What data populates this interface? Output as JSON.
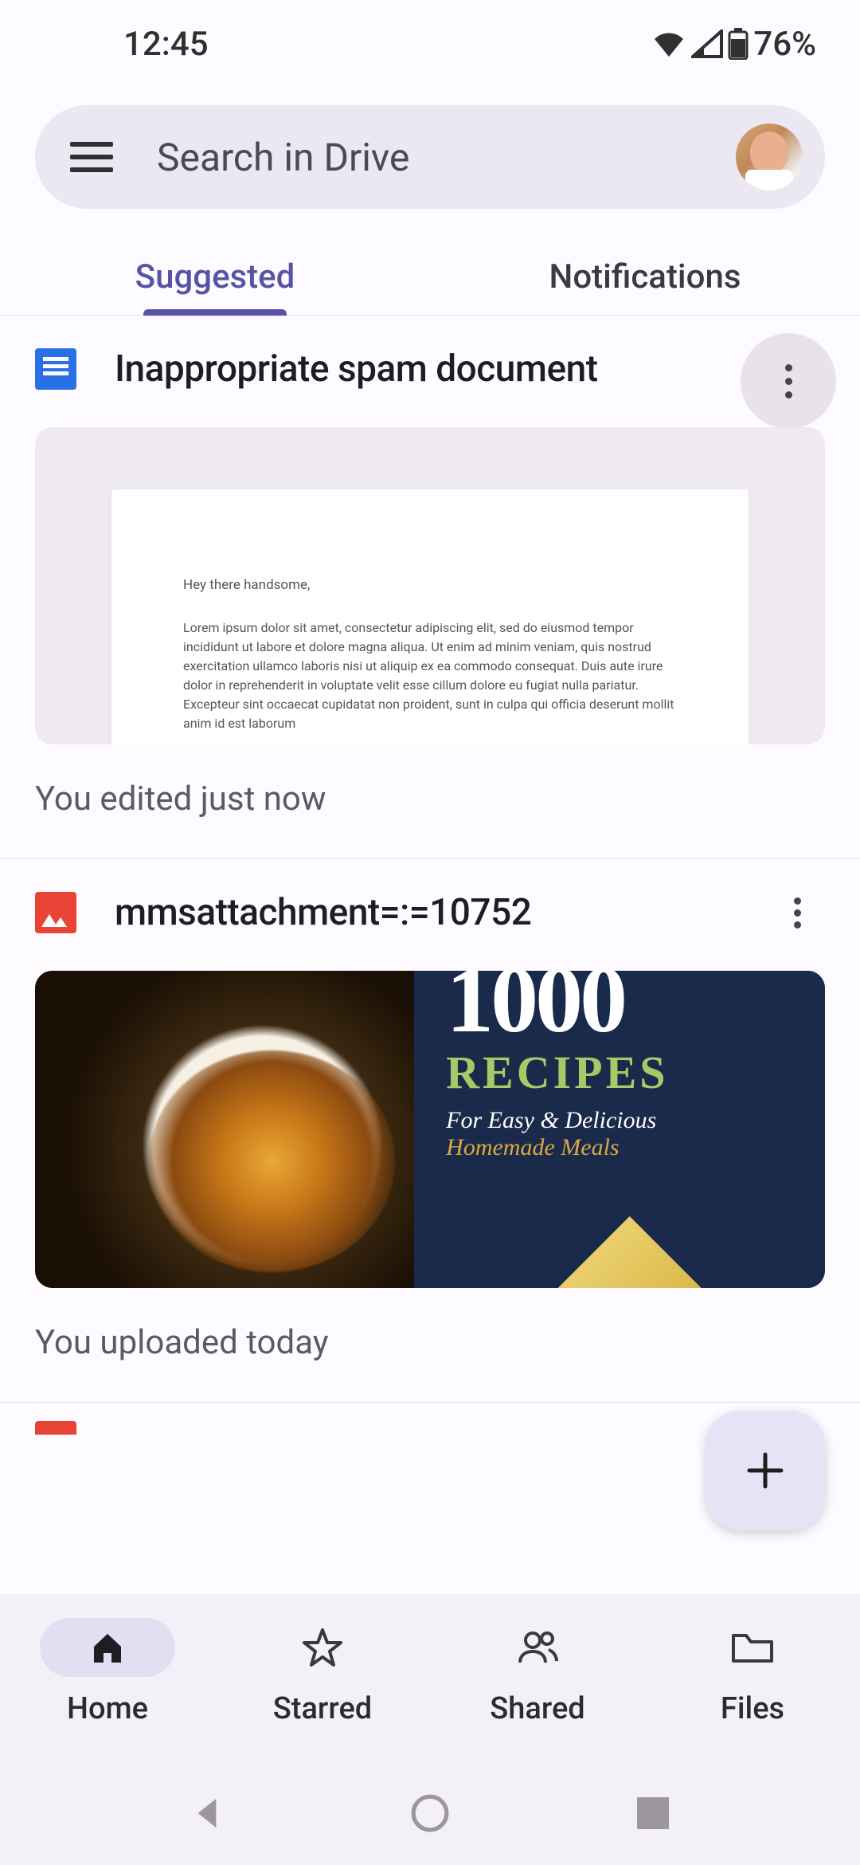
{
  "status": {
    "time": "12:45",
    "battery": "76%"
  },
  "search": {
    "placeholder": "Search in Drive"
  },
  "tabs": {
    "suggested": "Suggested",
    "notifications": "Notifications"
  },
  "items": [
    {
      "title": "Inappropriate spam document",
      "meta": "You edited just now",
      "preview": {
        "greeting": "Hey there handsome,",
        "body": "Lorem ipsum dolor sit amet, consectetur adipiscing elit, sed do eiusmod tempor incididunt ut labore et dolore magna aliqua. Ut enim ad minim veniam, quis nostrud exercitation ullamco laboris nisi ut aliquip ex ea commodo consequat. Duis aute irure dolor in reprehenderit in voluptate velit esse cillum dolore eu fugiat nulla pariatur. Excepteur sint occaecat cupidatat non proident, sunt in culpa qui officia deserunt mollit anim id est laborum"
      }
    },
    {
      "title": "mmsattachment=:=10752",
      "meta": "You uploaded today",
      "book": {
        "big": "1000",
        "recipes": "RECIPES",
        "sub1": "For Easy & Delicious",
        "sub2": "Homemade Meals"
      }
    }
  ],
  "nav": {
    "home": "Home",
    "starred": "Starred",
    "shared": "Shared",
    "files": "Files"
  }
}
